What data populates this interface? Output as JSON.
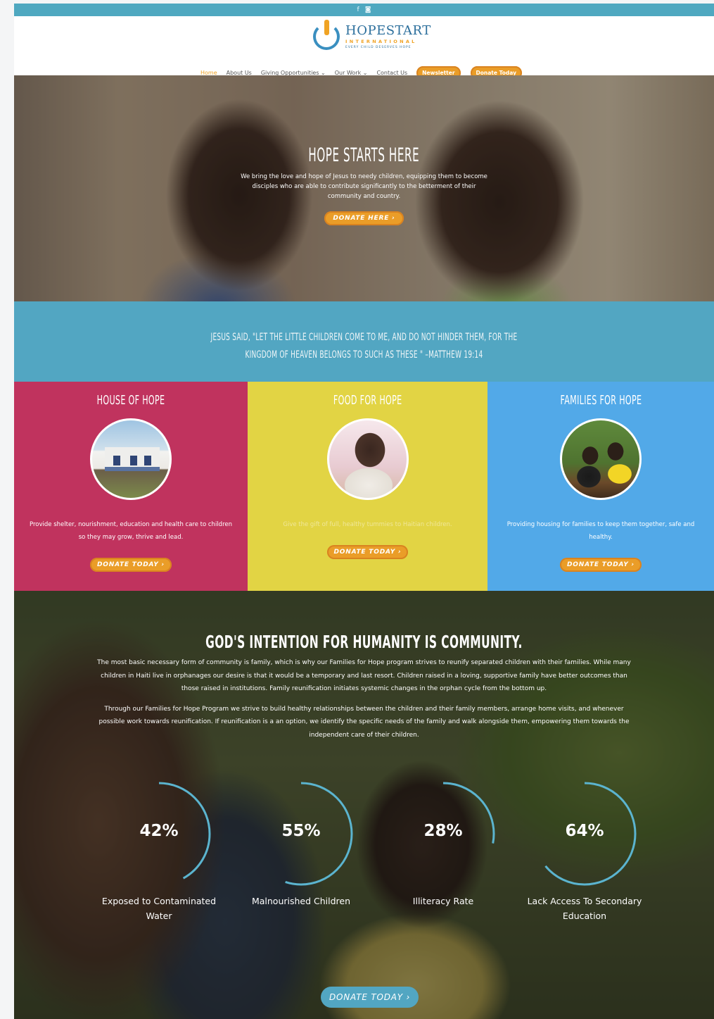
{
  "topbar": {
    "facebook_icon": "f",
    "instagram_icon": "◙"
  },
  "logo": {
    "name": "HOPESTART",
    "sub": "INTERNATIONAL",
    "tag": "EVERY CHILD DESERVES HOPE"
  },
  "nav": {
    "items": [
      "Home",
      "About Us",
      "Giving Opportunities ⌄",
      "Our Work ⌄",
      "Contact Us"
    ],
    "newsletter": "Newsletter",
    "donate": "Donate Today"
  },
  "hero": {
    "title": "HOPE STARTS HERE",
    "text": "We bring the love and hope of Jesus to needy children, equipping them to become disciples who are able to contribute significantly to the betterment of their community and country.",
    "button": "DONATE HERE ›"
  },
  "quote": {
    "line1": "JESUS SAID, \"LET THE LITTLE CHILDREN COME TO ME, AND DO NOT HINDER THEM, FOR THE",
    "line2": "KINGDOM OF HEAVEN BELONGS TO SUCH AS THESE \" –MATTHEW 19:14"
  },
  "columns": [
    {
      "title": "HOUSE OF HOPE",
      "text": "Provide shelter, nourishment, education and health care to children so they may grow, thrive and lead.",
      "button": "DONATE TODAY ›",
      "color": "#c0335e"
    },
    {
      "title": "FOOD FOR HOPE",
      "text": "Give the gift of full, healthy tummies to Haitian children.",
      "button": "DONATE TODAY ›",
      "color": "#e2d444"
    },
    {
      "title": "FAMILIES FOR HOPE",
      "text": "Providing housing for families to keep them together, safe and healthy.",
      "button": "DONATE TODAY ›",
      "color": "#52a9e8"
    }
  ],
  "community": {
    "title": "GOD'S INTENTION FOR HUMANITY IS COMMUNITY.",
    "p1": "The most basic necessary form of community is family, which is why our Families for Hope program strives to reunify separated children with their families. While many children in Haiti live in orphanages our desire is that it would be a temporary and last resort. Children raised in a loving, supportive family have better outcomes than those raised in institutions. Family reunification initiates systemic changes in the orphan cycle from the bottom up.",
    "p2": "Through our Families for Hope Program we strive to build healthy relationships between the children and their family members, arrange home visits, and whenever possible work towards reunification. If reunification is a an option, we identify the specific needs of the family and walk alongside them, empowering them towards the independent care of their children.",
    "stats": [
      {
        "value": 42,
        "label_text": "42%",
        "label": "Exposed to Contaminated Water"
      },
      {
        "value": 55,
        "label_text": "55%",
        "label": "Malnourished Children"
      },
      {
        "value": 28,
        "label_text": "28%",
        "label": "Illiteracy Rate"
      },
      {
        "value": 64,
        "label_text": "64%",
        "label": "Lack Access To Secondary Education"
      }
    ],
    "button": "DONATE TODAY ›"
  },
  "colors": {
    "accent_orange": "#ea9d28",
    "teal": "#52a6c2",
    "ring": "#5bb4cf"
  }
}
